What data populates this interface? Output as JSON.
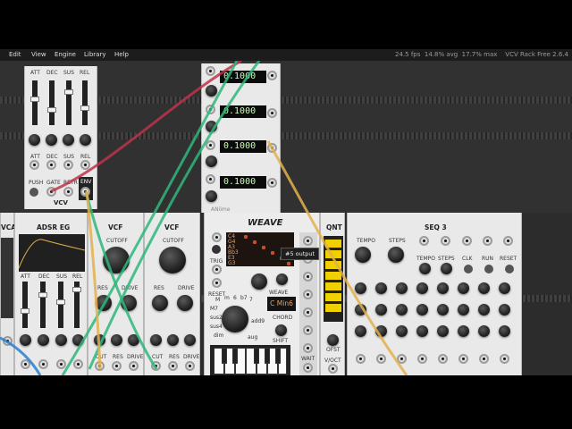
{
  "menu": {
    "items": [
      "Edit",
      "View",
      "Engine",
      "Library",
      "Help"
    ]
  },
  "status": {
    "fps": "24.5 fps",
    "avg": "14.8% avg",
    "max": "17.7% max",
    "app": "VCV Rack Free 2.6.4"
  },
  "adsr_top": {
    "sliders": [
      "ATT",
      "DEC",
      "SUS",
      "REL"
    ],
    "knobs": [
      "ATT",
      "DEC",
      "SUS",
      "REL"
    ],
    "jacks": [
      "PUSH",
      "GATE",
      "RETR",
      "ENV"
    ],
    "brand": "VCV"
  },
  "constants": {
    "displays": [
      "0.1000",
      "0.1000",
      "0.1000",
      "0.1000"
    ],
    "brand": "ANiime"
  },
  "tooltip": {
    "text": "#5 output"
  },
  "vca": {
    "title": "VCA"
  },
  "adsr_eg": {
    "title": "ADSR EG",
    "knobs": [
      "ATT",
      "DEC",
      "SUS",
      "REL"
    ]
  },
  "vcf1": {
    "title": "VCF",
    "cutoff": "CUTOFF",
    "res": "RES",
    "drive": "DRIVE",
    "jacks": [
      "CUT",
      "RES",
      "DRIVE"
    ]
  },
  "vcf2": {
    "title": "VCF",
    "cutoff": "CUTOFF",
    "res": "RES",
    "drive": "DRIVE",
    "jacks": [
      "CUT",
      "RES",
      "DRIVE"
    ]
  },
  "weave": {
    "title": "WEAVE",
    "sub_label": "WEAVE",
    "left_labels": [
      "TRIG",
      "RESET"
    ],
    "grid_labels": [
      "C4",
      "G4",
      "A3",
      "Bb3",
      "E3",
      "G3"
    ],
    "chord_display": "C Min6",
    "chord_label": "CHORD",
    "shift_label": "SHIFT",
    "wheel_labels": [
      "M",
      "m",
      "6",
      "b7",
      "7",
      "M7",
      "sus2",
      "sus4",
      "dim",
      "aug",
      "add9"
    ],
    "wait_label": "WAIT"
  },
  "qnt": {
    "title": "QNT",
    "ofst": "OFST",
    "voct": "V/OCT"
  },
  "seq3": {
    "title": "SEQ 3",
    "tempo": "TEMPO",
    "steps": "STEPS",
    "buttons": [
      "TEMPO",
      "STEPS",
      "CLK",
      "RUN",
      "RESET"
    ]
  },
  "cable_colors": {
    "red": "#c0334a",
    "green": "#2eb67a",
    "yellow": "#e3b04b",
    "blue": "#2a7fd0"
  }
}
